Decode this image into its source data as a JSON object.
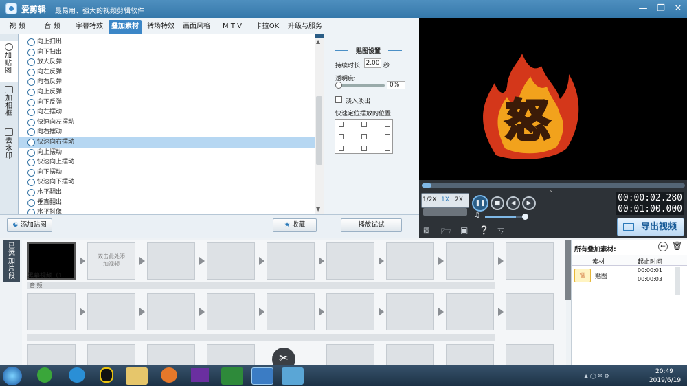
{
  "window": {
    "app_name": "爱剪辑",
    "slogan": "最易用、强大的视频剪辑软件",
    "min_icon": "minimize-icon",
    "max_icon": "maximize-icon",
    "close_icon": "close-icon"
  },
  "tabs": [
    {
      "label": "视  频"
    },
    {
      "label": "音  频"
    },
    {
      "label": "字幕特效"
    },
    {
      "label": "叠加素材",
      "active": true
    },
    {
      "label": "转场特效"
    },
    {
      "label": "画面风格"
    },
    {
      "label": "M T V"
    },
    {
      "label": "卡拉OK"
    },
    {
      "label": "升级与服务"
    }
  ],
  "left_vtabs": [
    {
      "label": "加贴图",
      "icon": "sticker-icon"
    },
    {
      "label": "加相框",
      "icon": "frame-icon"
    },
    {
      "label": "去水印",
      "icon": "watermark-icon"
    }
  ],
  "effects": [
    "向上扫出",
    "向下扫出",
    "放大反弹",
    "向左反弹",
    "向右反弹",
    "向上反弹",
    "向下反弹",
    "向左摆动",
    "快速向左摆动",
    "向右摆动",
    "快速向右摆动",
    "向上摆动",
    "快速向上摆动",
    "向下摆动",
    "快速向下摆动",
    "水平翻出",
    "垂直翻出",
    "水平抖像"
  ],
  "selected_effect": "快速向右摆动",
  "settings": {
    "title": "贴图设置",
    "duration_label": "持续时长:",
    "duration_value": "2.00",
    "duration_unit": "秒",
    "opacity_label": "透明度:",
    "opacity_value": "0%",
    "fade_label": "淡入淡出",
    "position_label": "快速定位摆放的位置:",
    "play_test": "播放试试"
  },
  "buttons": {
    "add_sticker": "添加贴图",
    "favorite": "收藏"
  },
  "player": {
    "speeds": [
      "1/2X",
      "1X",
      "2X"
    ],
    "current_time": "00:00:02.280",
    "total_time": "00:01:00.000",
    "export": "导出视频",
    "progress": 0.03,
    "volume": 0.75,
    "overlay_glyph": "怒"
  },
  "added_tab": "已添加片段",
  "clips": [
    {
      "label": "黑幕视频（1..."
    },
    {
      "label": "双击此处添加视频"
    }
  ],
  "audio_label": "音  频",
  "right_pane": {
    "title": "所有叠加素材:",
    "col_material": "素材",
    "col_time": "起止时间",
    "rows": [
      {
        "name": "贴图",
        "start": "00:00:01",
        "end": "00:00:03"
      }
    ]
  },
  "taskbar": {
    "time": "20:49",
    "date": "2019/6/19"
  }
}
